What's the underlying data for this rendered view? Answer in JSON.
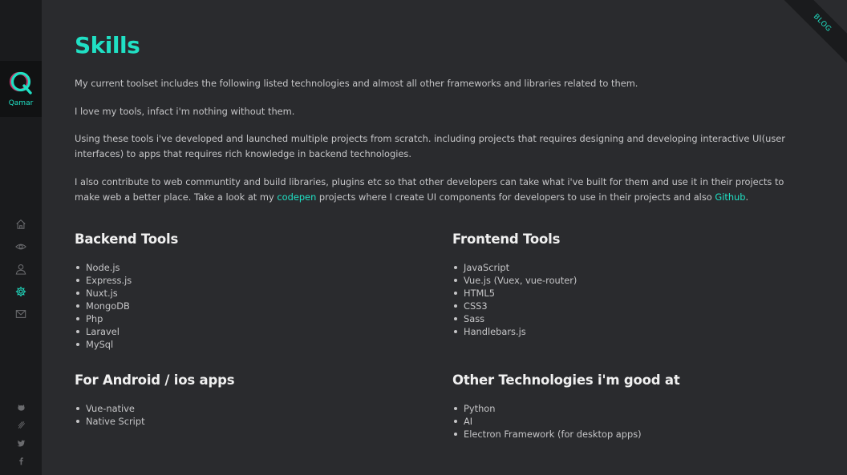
{
  "brand": {
    "logo_letter": "Q",
    "logo_text": "Qamar",
    "accent": "#20e0c4"
  },
  "ribbon": {
    "label": "BLOG"
  },
  "nav": [
    {
      "name": "home-icon"
    },
    {
      "name": "eye-icon"
    },
    {
      "name": "user-icon"
    },
    {
      "name": "gear-icon",
      "active": true
    },
    {
      "name": "mail-icon"
    }
  ],
  "social": [
    {
      "name": "github-icon"
    },
    {
      "name": "codepen-icon"
    },
    {
      "name": "twitter-icon"
    },
    {
      "name": "facebook-icon"
    }
  ],
  "page": {
    "title": "Skills",
    "p1": "My current toolset includes the following listed technologies and almost all other frameworks and libraries related to them.",
    "p2": "I love my tools, infact i'm nothing without them.",
    "p3": "Using these tools i've developed and launched multiple projects from scratch. including projects that requires designing and developing interactive UI(user interfaces) to apps that requires rich knowledge in backend technologies.",
    "p4_a": "I also contribute to web communtity and build libraries, plugins etc so that other developers can take what i've built for them and use it in their projects to make web a better place. Take a look at my ",
    "p4_link1": "codepen",
    "p4_b": " projects where I create UI components for developers to use in their projects and also ",
    "p4_link2": "Github",
    "p4_c": "."
  },
  "sections": {
    "backend": {
      "title": "Backend Tools",
      "items": [
        "Node.js",
        "Express.js",
        "Nuxt.js",
        "MongoDB",
        "Php",
        "Laravel",
        "MySql"
      ]
    },
    "frontend": {
      "title": "Frontend Tools",
      "items": [
        "JavaScript",
        "Vue.js (Vuex, vue-router)",
        "HTML5",
        "CSS3",
        "Sass",
        "Handlebars.js"
      ]
    },
    "android": {
      "title": "For Android / ios apps",
      "items": [
        "Vue-native",
        "Native Script"
      ]
    },
    "other": {
      "title": "Other Technologies i'm good at",
      "items": [
        "Python",
        "AI",
        "Electron Framework (for desktop apps)"
      ]
    }
  }
}
